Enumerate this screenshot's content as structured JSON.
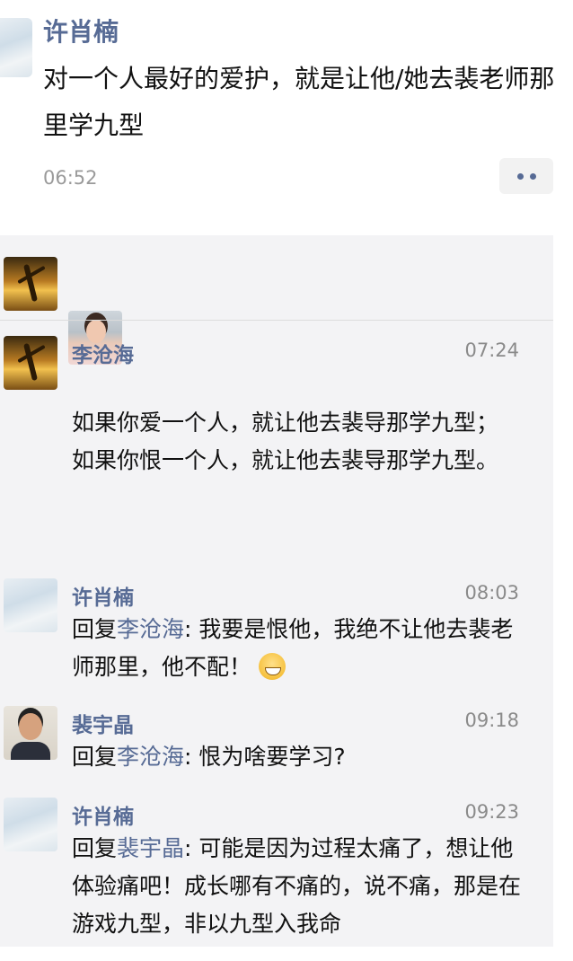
{
  "post": {
    "author": "许肖楠",
    "content": "对一个人最好的爱护，就是让他/她去裴老师那里学九型",
    "time": "06:52",
    "avatar_icon": "cloud-avatar-icon"
  },
  "likes": {
    "avatars": [
      "dancer-sunset-avatar",
      "woman-portrait-avatar"
    ]
  },
  "comments": [
    {
      "author": "李沧海",
      "time": "07:24",
      "text": "如果你爱一个人，就让他去裴导那学九型；\n如果你恨一个人，就让他去裴导那学九型。"
    },
    {
      "author": "许肖楠",
      "time": "08:03",
      "reply_prefix": "回复",
      "reply_to": "李沧海",
      "text": ": 我要是恨他，我绝不让他去裴老师那里，他不配！",
      "emoji": "grin-emoji-icon"
    },
    {
      "author": "裴宇晶",
      "time": "09:18",
      "reply_prefix": "回复",
      "reply_to": "李沧海",
      "text": ": 恨为啥要学习?"
    },
    {
      "author": "许肖楠",
      "time": "09:23",
      "reply_prefix": "回复",
      "reply_to": "裴宇晶",
      "text": ": 可能是因为过程太痛了，想让他体验痛吧！成长哪有不痛的，说不痛，那是在游戏九型，非以九型入我命"
    }
  ],
  "colors": {
    "link": "#576b95",
    "comment_bg": "#f3f3f5",
    "time": "#9a9a9a"
  }
}
